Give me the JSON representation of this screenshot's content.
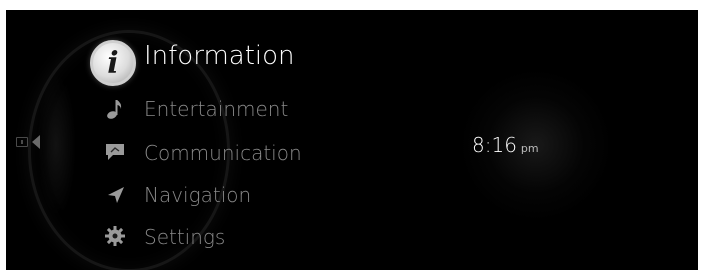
{
  "menu": {
    "items": [
      {
        "label": "Information",
        "icon": "information-icon"
      },
      {
        "label": "Entertainment",
        "icon": "music-note-icon"
      },
      {
        "label": "Communication",
        "icon": "chat-bubble-icon"
      },
      {
        "label": "Navigation",
        "icon": "navigation-arrow-icon"
      },
      {
        "label": "Settings",
        "icon": "gear-icon"
      }
    ],
    "selected_index": 0
  },
  "clock": {
    "time": "8:16",
    "period": "pm"
  },
  "colors": {
    "background": "#000000",
    "selected_text": "#ffffff",
    "unselected_text": "#8a8a8a"
  }
}
